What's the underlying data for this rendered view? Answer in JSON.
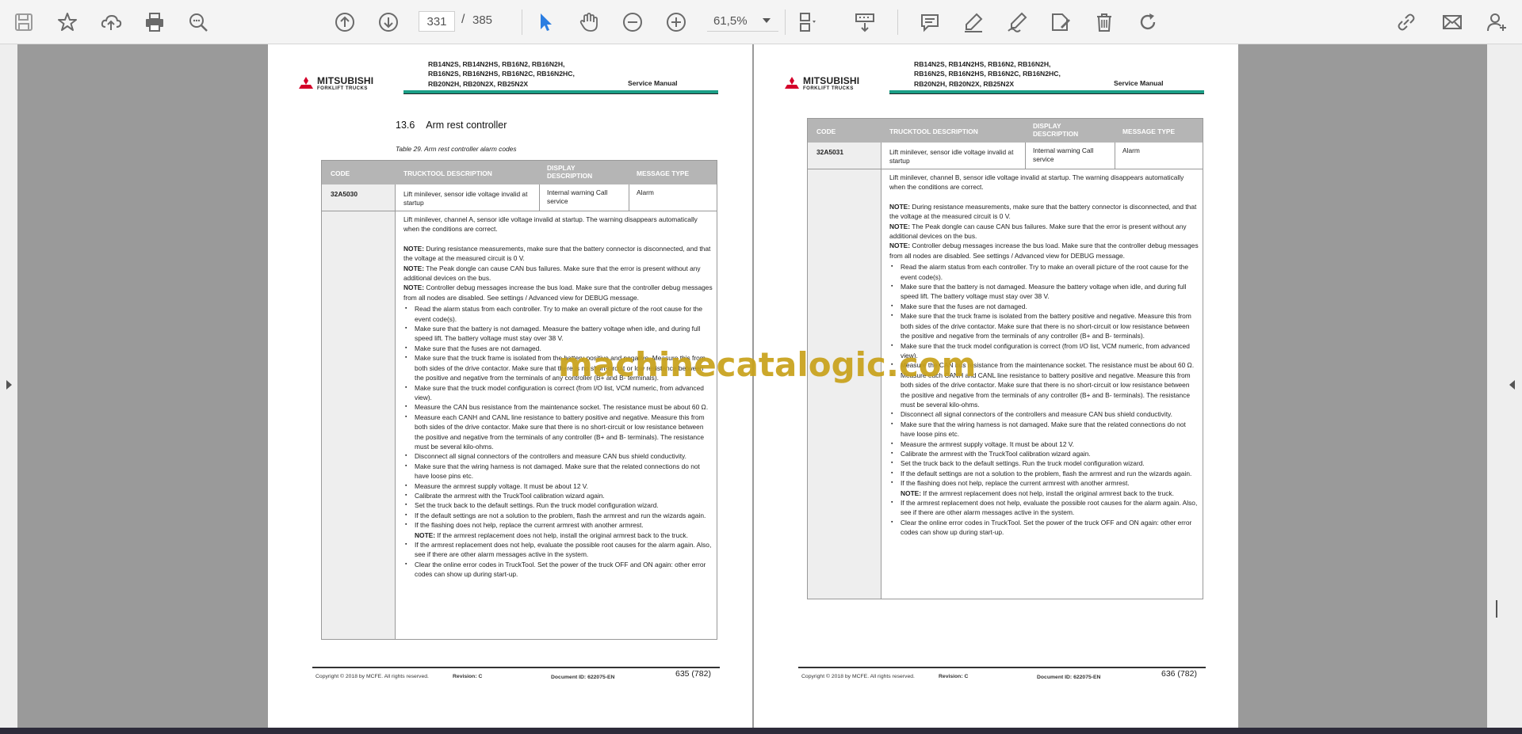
{
  "toolbar": {
    "page_current": "331",
    "page_separator": "/",
    "page_total": "385",
    "zoom": "61,5%"
  },
  "doc": {
    "brand": "MITSUBISHI",
    "brand_sub": "FORKLIFT TRUCKS",
    "models": [
      "RB14N2S, RB14N2HS, RB16N2, RB16N2H,",
      "RB16N2S, RB16N2HS, RB16N2C, RB16N2HC,",
      "RB20N2H, RB20N2X, RB25N2X"
    ],
    "service_manual": "Service Manual",
    "copyright": "Copyright © 2018 by MCFE. All rights reserved.",
    "revision": "Revision: C",
    "document_id": "Document ID: 622075-EN",
    "headers": {
      "code": "CODE",
      "trucktool": "TRUCKTOOL DESCRIPTION",
      "display": "DISPLAY DESCRIPTION",
      "message": "MESSAGE TYPE"
    }
  },
  "left_page": {
    "section_number": "13.6",
    "section_title": "Arm rest controller",
    "table_caption": "Table 29. Arm rest controller alarm codes",
    "page_number": "635 (782)",
    "row": {
      "code": "32A5030",
      "description": "Lift minilever, sensor idle voltage invalid at startup",
      "display": "Internal warning Call service",
      "type": "Alarm"
    },
    "body": {
      "intro": "Lift minilever, channel A, sensor idle voltage invalid at startup. The warning disappears automatically when the conditions are correct.",
      "note1": "During resistance measurements, make sure that the battery connector is disconnected, and that the voltage at the measured circuit is 0 V.",
      "note2": "The Peak dongle can cause CAN bus failures. Make sure that the error is present without any additional devices on the bus.",
      "note3": "Controller debug messages increase the bus load. Make sure that the controller debug messages from all nodes are disabled. See settings / Advanced view for DEBUG message.",
      "bullets": [
        "Read the alarm status from each controller. Try to make an overall picture of the root cause for the event code(s).",
        "Make sure that the battery is not damaged. Measure the battery voltage when idle, and during full speed lift. The battery voltage must stay over 38 V.",
        "Make sure that the fuses are not damaged.",
        "Make sure that the truck frame is isolated from the battery positive and negative. Measure this from both sides of the drive contactor. Make sure that there is no short-circuit or low resistance between the positive and negative from the terminals of any controller (B+ and B- terminals).",
        "Make sure that the truck model configuration is correct (from I/O list, VCM numeric, from advanced view).",
        "Measure the CAN bus resistance from the maintenance socket. The resistance must be about 60 Ω.",
        "Measure each CANH and CANL line resistance to battery positive and negative. Measure this from both sides of the drive contactor. Make sure that there is no short-circuit or low resistance between the positive and negative from the terminals of any controller (B+ and B- terminals). The resistance must be several kilo-ohms.",
        "Disconnect all signal connectors of the controllers and measure CAN bus shield conductivity.",
        "Make sure that the wiring harness is not damaged. Make sure that the related connections do not have loose pins etc.",
        "Measure the armrest supply voltage. It must be about 12 V.",
        "Calibrate the armrest with the TruckTool calibration wizard again.",
        "Set the truck back to the default settings. Run the truck model configuration wizard.",
        "If the default settings are not a solution to the problem, flash the armrest and run the wizards again.",
        "If the flashing does not help, replace the current armrest with another armrest.",
        "If the armrest replacement does not help, evaluate the possible root causes for the alarm again. Also, see if there are other alarm messages active in the system.",
        "Clear the online error codes in TruckTool. Set the power of the truck OFF and ON again: other error codes can show up during start-up."
      ],
      "inline_note": "If the armrest replacement does not help, install the original armrest back to the truck."
    }
  },
  "right_page": {
    "page_number": "636 (782)",
    "row": {
      "code": "32A5031",
      "description": "Lift minilever, sensor idle voltage invalid at startup",
      "display": "Internal warning Call service",
      "type": "Alarm"
    },
    "body": {
      "intro": "Lift minilever, channel B, sensor idle voltage invalid at startup. The warning disappears automatically when the conditions are correct."
    }
  },
  "note_label": "NOTE:",
  "watermark": "machinecatalogic.com"
}
